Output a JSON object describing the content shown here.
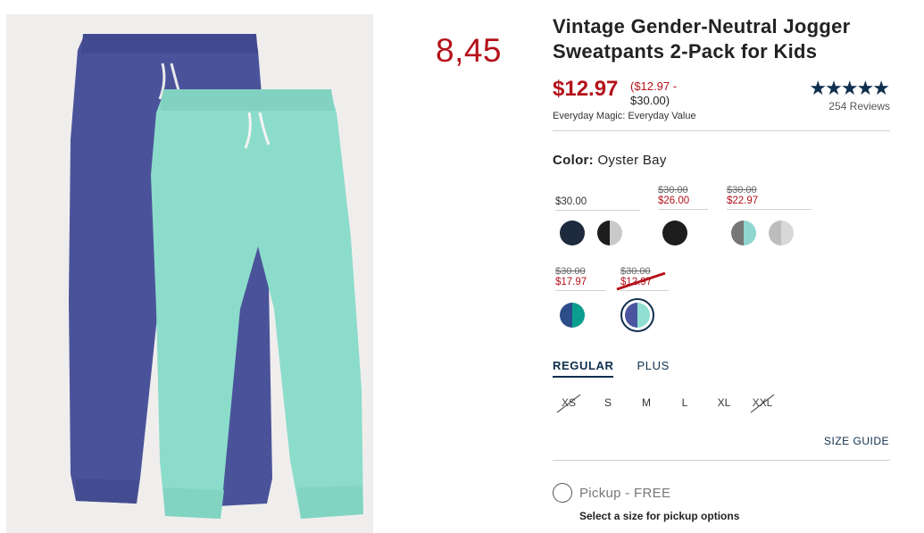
{
  "overlay": {
    "value": "8,45"
  },
  "product": {
    "title": "Vintage Gender-Neutral Jogger Sweatpants 2-Pack for Kids",
    "sale_price": "$12.97",
    "range_open": "($12.97 -",
    "range_close": "$30.00)",
    "magic": "Everyday Magic: Everyday Value",
    "stars": "★★★★★",
    "reviews": "254 Reviews"
  },
  "color": {
    "label": "Color:",
    "value": "Oyster Bay"
  },
  "swatch_groups": [
    {
      "orig": "",
      "price": "$30.00",
      "swatches": [
        [
          "#1e2a3d",
          "#1e2a3d"
        ],
        [
          "#1d1d1d",
          "#c9c9c9"
        ]
      ]
    },
    {
      "orig": "$30.00",
      "price": "$26.00",
      "swatches": [
        [
          "#1d1d1d",
          "#1d1d1d"
        ]
      ]
    },
    {
      "orig": "$30.00",
      "price": "$22.97",
      "swatches": [
        [
          "#777777",
          "#8fd6cf"
        ],
        [
          "#bdbdbd",
          "#d8d8d8"
        ]
      ]
    },
    {
      "orig": "$30.00",
      "price": "$17.97",
      "swatches": [
        [
          "#2c4c8a",
          "#0b9e8f"
        ]
      ]
    },
    {
      "orig": "$30.00",
      "price": "$12.97",
      "swatches": [
        [
          "#4b55a0",
          "#8fe0d2"
        ]
      ]
    }
  ],
  "fit": {
    "regular": "REGULAR",
    "plus": "PLUS"
  },
  "sizes": [
    "XS",
    "S",
    "M",
    "L",
    "XL",
    "XXL"
  ],
  "size_guide": "SIZE GUIDE",
  "pickup": {
    "label": "Pickup - FREE",
    "note": "Select a size for pickup options"
  },
  "colors": {
    "accent_navy": "#0f2f4e",
    "sale_red": "#b4121b"
  }
}
